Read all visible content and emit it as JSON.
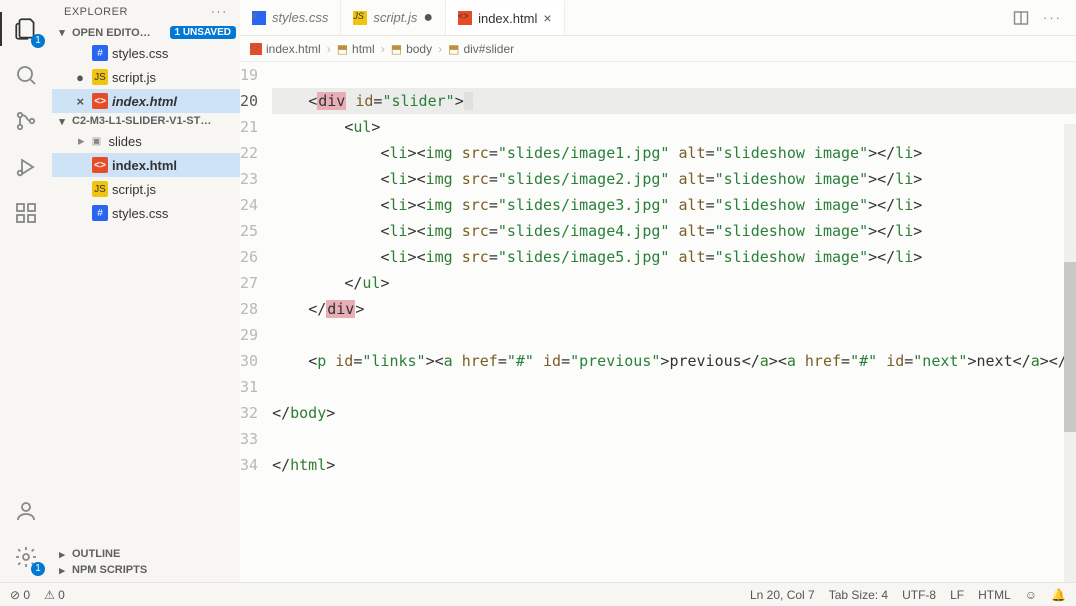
{
  "sidebar": {
    "title": "EXPLORER",
    "open_editors": {
      "label": "OPEN EDITO…",
      "unsaved_label": "1 UNSAVED",
      "items": [
        {
          "name": "styles.css",
          "type": "css",
          "dirty": false
        },
        {
          "name": "script.js",
          "type": "js",
          "dirty": true
        },
        {
          "name": "index.html",
          "type": "html",
          "dirty": false,
          "selected": true
        }
      ]
    },
    "folder": {
      "label": "C2-M3-L1-SLIDER-V1-ST…",
      "items": [
        {
          "name": "slides",
          "type": "folder"
        },
        {
          "name": "index.html",
          "type": "html",
          "selected": true
        },
        {
          "name": "script.js",
          "type": "js"
        },
        {
          "name": "styles.css",
          "type": "css"
        }
      ]
    },
    "outline": "OUTLINE",
    "npm": "NPM SCRIPTS"
  },
  "tabs": [
    {
      "name": "styles.css",
      "type": "css",
      "dirty": false
    },
    {
      "name": "script.js",
      "type": "js",
      "dirty": true
    },
    {
      "name": "index.html",
      "type": "html",
      "active": true
    }
  ],
  "breadcrumb": [
    {
      "label": "index.html",
      "icon": "html"
    },
    {
      "label": "html",
      "icon": "tag"
    },
    {
      "label": "body",
      "icon": "tag"
    },
    {
      "label": "div#slider",
      "icon": "tag"
    }
  ],
  "editor": {
    "first_line": 19,
    "active_line": 20,
    "lines": [
      {
        "n": 19,
        "txt": ""
      },
      {
        "n": 20,
        "txt_open_div": true
      },
      {
        "n": 21,
        "txt_ul_open": true
      },
      {
        "n": 22,
        "img": "slides/image1.jpg"
      },
      {
        "n": 23,
        "img": "slides/image2.jpg"
      },
      {
        "n": 24,
        "img": "slides/image3.jpg"
      },
      {
        "n": 25,
        "img": "slides/image4.jpg"
      },
      {
        "n": 26,
        "img": "slides/image5.jpg"
      },
      {
        "n": 27,
        "txt_ul_close": true
      },
      {
        "n": 28,
        "txt_close_div": true
      },
      {
        "n": 29,
        "txt": ""
      },
      {
        "n": 30,
        "p_links": true
      },
      {
        "n": 31,
        "txt": ""
      },
      {
        "n": 32,
        "close": "body"
      },
      {
        "n": 33,
        "txt": ""
      },
      {
        "n": 34,
        "close": "html"
      }
    ],
    "alt_text": "slideshow image",
    "p_prev": "previous",
    "p_next": "next"
  },
  "status": {
    "errors": "0",
    "warnings": "0",
    "ln_col": "Ln 20, Col 7",
    "spaces": "Tab Size: 4",
    "encoding": "UTF-8",
    "eol": "LF",
    "lang": "HTML"
  },
  "activity_badge": "1"
}
